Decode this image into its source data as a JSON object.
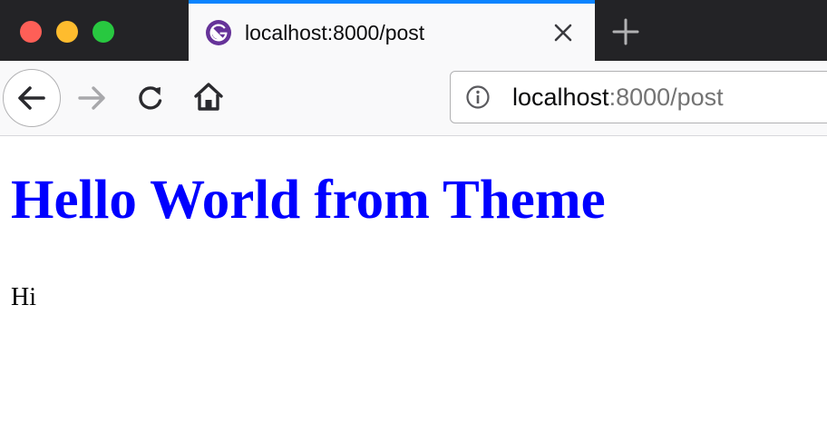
{
  "window": {
    "traffic_lights": [
      "close",
      "minimize",
      "maximize"
    ]
  },
  "tab": {
    "title": "localhost:8000/post",
    "favicon": "gatsby-icon",
    "accent_color": "#0a84ff",
    "favicon_color": "#663399"
  },
  "toolbar": {
    "url_host": "localhost",
    "url_rest": ":8000/post"
  },
  "page": {
    "heading": "Hello World from Theme",
    "heading_color": "#0000ff",
    "paragraph": "Hi"
  }
}
